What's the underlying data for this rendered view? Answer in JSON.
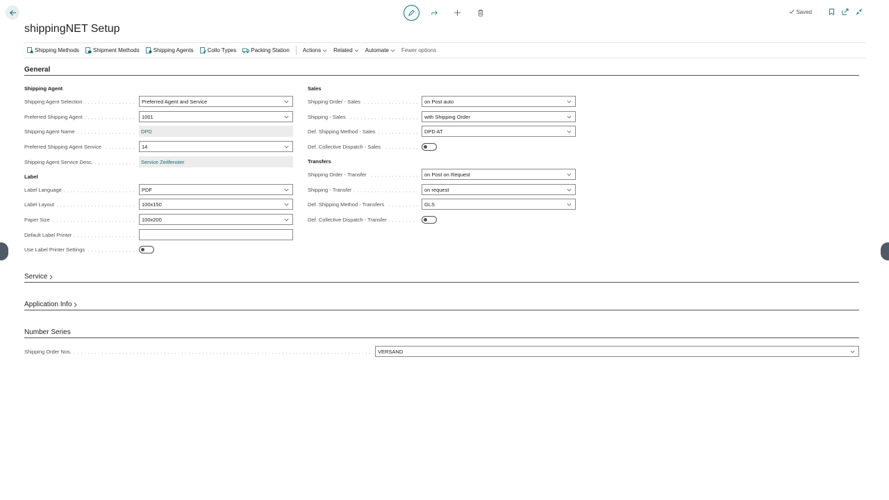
{
  "header": {
    "title": "shippingNET Setup",
    "saved_label": "Saved"
  },
  "actionbar": {
    "items": [
      "Shipping Methods",
      "Shipment Methods",
      "Shipping Agents",
      "Collo Types",
      "Packing Station"
    ],
    "menus": [
      "Actions",
      "Related",
      "Automate"
    ],
    "fewer_options": "Fewer options"
  },
  "general": {
    "title": "General",
    "shipping_agent_group": "Shipping Agent",
    "label_group": "Label",
    "sales_group": "Sales",
    "transfers_group": "Transfers",
    "fields": {
      "agent_selection": {
        "label": "Shipping Agent Selection",
        "value": "Preferred Agent and Service"
      },
      "preferred_agent": {
        "label": "Preferred Shipping Agent",
        "value": "1001"
      },
      "agent_name": {
        "label": "Shipping Agent Name",
        "value": "DPD"
      },
      "preferred_service": {
        "label": "Preferred Shipping Agent Service",
        "value": "14"
      },
      "service_desc": {
        "label": "Shipping Agent Service Desc.",
        "value": "Service Zeitfenster"
      },
      "label_language": {
        "label": "Label Language",
        "value": "PDF"
      },
      "label_layout": {
        "label": "Label Layout",
        "value": "100x150"
      },
      "paper_size": {
        "label": "Paper Size",
        "value": "100x200"
      },
      "default_printer": {
        "label": "Default Label Printer",
        "value": ""
      },
      "use_printer_settings": {
        "label": "Use Label Printer Settings",
        "on": false
      },
      "order_sales": {
        "label": "Shipping Order - Sales",
        "value": "on Post auto"
      },
      "shipping_sales": {
        "label": "Shipping - Sales",
        "value": "with Shipping Order"
      },
      "method_sales": {
        "label": "Def. Shipping Method - Sales",
        "value": "DPD AT"
      },
      "collective_sales": {
        "label": "Def. Collective Dispatch - Sales",
        "on": false
      },
      "order_transfer": {
        "label": "Shipping Order - Transfer",
        "value": "on Post on Request"
      },
      "shipping_transfer": {
        "label": "Shipping - Transfer",
        "value": "on request"
      },
      "method_transfers": {
        "label": "Def. Shipping Method - Transfers",
        "value": "GLS"
      },
      "collective_transfer": {
        "label": "Def. Collective Dispatch - Transfer",
        "on": false
      }
    }
  },
  "service": {
    "title": "Service"
  },
  "application_info": {
    "title": "Application Info"
  },
  "number_series": {
    "title": "Number Series",
    "order_nos": {
      "label": "Shipping Order Nos.",
      "value": "VERSAND"
    }
  },
  "colors": {
    "accent": "#0f6e78",
    "text": "#212121",
    "muted": "#505050"
  }
}
